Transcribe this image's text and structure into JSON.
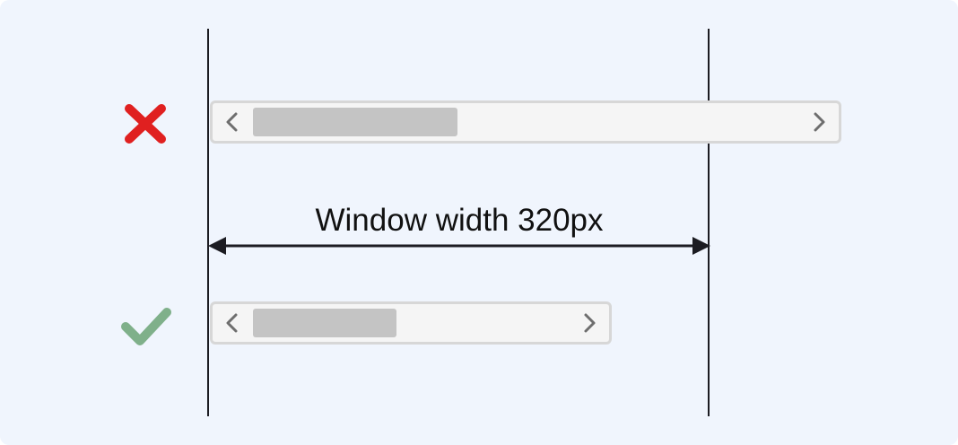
{
  "diagram": {
    "measurement_label": "Window width 320px",
    "examples": [
      {
        "status": "incorrect",
        "icon": "cross-icon",
        "color": "#e02020"
      },
      {
        "status": "correct",
        "icon": "checkmark-icon",
        "color": "#7fb08a"
      }
    ],
    "colors": {
      "background": "#f0f5fd",
      "guide_line": "#1c1c22",
      "scrollbar_track": "#f5f5f5",
      "scrollbar_border": "#d7d7d7",
      "scrollbar_thumb": "#c4c4c4",
      "chevron": "#6e6e6e"
    }
  }
}
